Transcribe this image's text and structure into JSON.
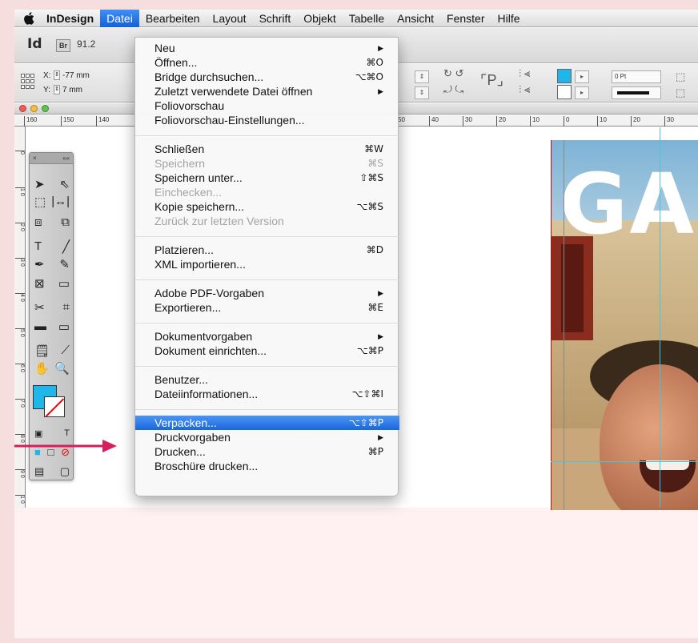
{
  "menubar": {
    "app_name": "InDesign",
    "items": [
      "Datei",
      "Bearbeiten",
      "Layout",
      "Schrift",
      "Objekt",
      "Tabelle",
      "Ansicht",
      "Fenster",
      "Hilfe"
    ],
    "active": "Datei"
  },
  "appbar": {
    "logo": "Id",
    "bridge": "Br",
    "zoom": "91.2"
  },
  "control": {
    "x_label": "X:",
    "x_value": "-77 mm",
    "y_label": "Y:",
    "y_value": "7 mm",
    "stroke_weight": "0 Pt",
    "fill_color": "#1fb7ea"
  },
  "ruler": {
    "h_ticks": [
      "160",
      "150",
      "140",
      "50",
      "40",
      "30",
      "20",
      "10",
      "0",
      "10",
      "20",
      "30"
    ],
    "v_ticks": [
      "0",
      "1 0",
      "2 0",
      "3 0",
      "4 0",
      "5 0",
      "6 0",
      "7 0",
      "8 0",
      "9 0",
      "1 0"
    ]
  },
  "document": {
    "headline": "GA"
  },
  "datei_menu": {
    "groups": [
      [
        {
          "label": "Neu",
          "shortcut": "",
          "submenu": true,
          "disabled": false
        },
        {
          "label": "Öffnen...",
          "shortcut": "⌘O",
          "submenu": false,
          "disabled": false
        },
        {
          "label": "Bridge durchsuchen...",
          "shortcut": "⌥⌘O",
          "submenu": false,
          "disabled": false
        },
        {
          "label": "Zuletzt verwendete Datei öffnen",
          "shortcut": "",
          "submenu": true,
          "disabled": false
        },
        {
          "label": "Foliovorschau",
          "shortcut": "",
          "submenu": false,
          "disabled": false
        },
        {
          "label": "Foliovorschau-Einstellungen...",
          "shortcut": "",
          "submenu": false,
          "disabled": false
        }
      ],
      [
        {
          "label": "Schließen",
          "shortcut": "⌘W",
          "submenu": false,
          "disabled": false
        },
        {
          "label": "Speichern",
          "shortcut": "⌘S",
          "submenu": false,
          "disabled": true
        },
        {
          "label": "Speichern unter...",
          "shortcut": "⇧⌘S",
          "submenu": false,
          "disabled": false
        },
        {
          "label": "Einchecken...",
          "shortcut": "",
          "submenu": false,
          "disabled": true
        },
        {
          "label": "Kopie speichern...",
          "shortcut": "⌥⌘S",
          "submenu": false,
          "disabled": false
        },
        {
          "label": "Zurück zur letzten Version",
          "shortcut": "",
          "submenu": false,
          "disabled": true
        }
      ],
      [
        {
          "label": "Platzieren...",
          "shortcut": "⌘D",
          "submenu": false,
          "disabled": false
        },
        {
          "label": "XML importieren...",
          "shortcut": "",
          "submenu": false,
          "disabled": false
        }
      ],
      [
        {
          "label": "Adobe PDF-Vorgaben",
          "shortcut": "",
          "submenu": true,
          "disabled": false
        },
        {
          "label": "Exportieren...",
          "shortcut": "⌘E",
          "submenu": false,
          "disabled": false
        }
      ],
      [
        {
          "label": "Dokumentvorgaben",
          "shortcut": "",
          "submenu": true,
          "disabled": false
        },
        {
          "label": "Dokument einrichten...",
          "shortcut": "⌥⌘P",
          "submenu": false,
          "disabled": false
        }
      ],
      [
        {
          "label": "Benutzer...",
          "shortcut": "",
          "submenu": false,
          "disabled": false
        },
        {
          "label": "Dateiinformationen...",
          "shortcut": "⌥⇧⌘I",
          "submenu": false,
          "disabled": false
        }
      ],
      [
        {
          "label": "Verpacken...",
          "shortcut": "⌥⇧⌘P",
          "submenu": false,
          "disabled": false,
          "selected": true
        },
        {
          "label": "Druckvorgaben",
          "shortcut": "",
          "submenu": true,
          "disabled": false
        },
        {
          "label": "Drucken...",
          "shortcut": "⌘P",
          "submenu": false,
          "disabled": false
        },
        {
          "label": "Broschüre drucken...",
          "shortcut": "",
          "submenu": false,
          "disabled": false
        }
      ]
    ]
  }
}
